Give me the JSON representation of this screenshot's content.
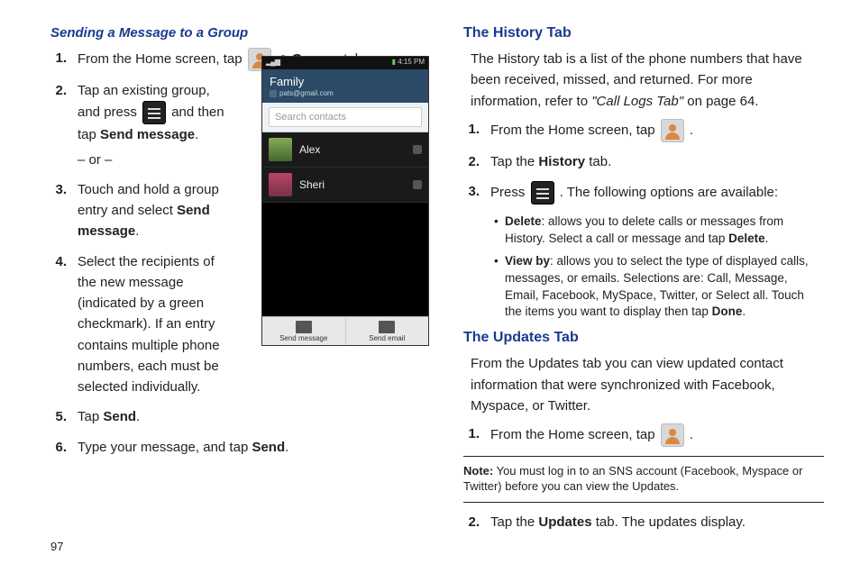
{
  "left": {
    "heading": "Sending a Message to a Group",
    "step1_a": "From the Home screen, tap ",
    "step1_b": " ",
    "step1_c": "Groups",
    "step1_d": " tab.",
    "arrow": "➔",
    "step2_a": "Tap an existing group, and press ",
    "step2_b": " and then tap ",
    "step2_c": "Send message",
    "step2_d": ".",
    "step2_or": "– or –",
    "step3_a": "Touch and hold a group entry and select ",
    "step3_b": "Send message",
    "step3_c": ".",
    "step4": "Select the recipients of the new message (indicated by a green checkmark). If an entry contains multiple phone numbers, each must be selected individually.",
    "step5_a": "Tap ",
    "step5_b": "Send",
    "step5_c": ".",
    "step6_a": "Type your message, and tap ",
    "step6_b": "Send",
    "step6_c": ".",
    "nums": {
      "n1": "1.",
      "n2": "2.",
      "n3": "3.",
      "n4": "4.",
      "n5": "5.",
      "n6": "6."
    }
  },
  "phone": {
    "time": "4:15 PM",
    "family": "Family",
    "email": "pats@gmail.com",
    "search": "Search contacts",
    "row1": "Alex",
    "row2": "Sheri",
    "btn1": "Send message",
    "btn2": "Send email"
  },
  "right": {
    "h1": "The History Tab",
    "p1_a": "The History tab is a list of the phone numbers that have been received, missed, and returned. For more information, refer to ",
    "p1_b": "\"Call Logs Tab\"",
    "p1_c": "  on page 64.",
    "s1": "From the Home screen, tap ",
    "s1_end": " .",
    "s2_a": "Tap the ",
    "s2_b": "History",
    "s2_c": " tab.",
    "s3_a": "Press ",
    "s3_b": ". The following options are available:",
    "b1_a": "Delete",
    "b1_b": ": allows you to delete calls or messages from History. Select a call or message and tap ",
    "b1_c": "Delete",
    "b1_d": ".",
    "b2_a": "View by",
    "b2_b": ": allows you to select the type of displayed calls, messages, or emails. Selections are: Call, Message, Email, Facebook, MySpace, Twitter, or Select all. Touch the items you want to display then tap ",
    "b2_c": "Done",
    "b2_d": ".",
    "h2": "The Updates Tab",
    "p2": "From the Updates tab you can view updated contact information that were synchronized with Facebook, Myspace, or Twitter.",
    "u1": "From the Home screen, tap ",
    "u1_end": " .",
    "note_a": "Note:",
    "note_b": " You must log in to an SNS account (Facebook, Myspace or Twitter) before you can view the Updates.",
    "u2_a": "Tap the ",
    "u2_b": "Updates",
    "u2_c": " tab. The updates display.",
    "nums": {
      "n1": "1.",
      "n2": "2.",
      "n3": "3."
    }
  },
  "page_num": "97"
}
